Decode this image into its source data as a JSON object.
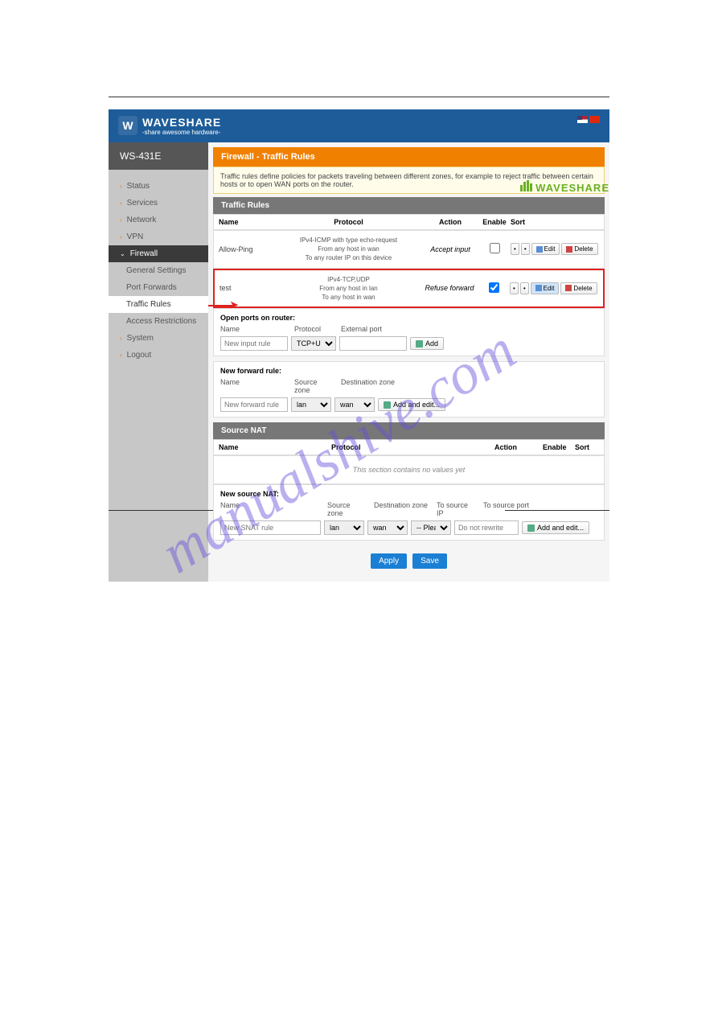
{
  "brand": {
    "name": "WAVESHARE",
    "tagline": "-share awesome hardware-"
  },
  "device": "WS-431E",
  "nav": {
    "status": "Status",
    "services": "Services",
    "network": "Network",
    "vpn": "VPN",
    "firewall": "Firewall",
    "system": "System",
    "logout": "Logout"
  },
  "subnav": {
    "general": "General Settings",
    "portfwd": "Port Forwards",
    "traffic": "Traffic Rules",
    "access": "Access Restrictions"
  },
  "page": {
    "title": "Firewall - Traffic Rules",
    "desc": "Traffic rules define policies for packets traveling between different zones, for example to reject traffic between certain hosts or to open WAN ports on the router."
  },
  "traffic": {
    "section": "Traffic Rules",
    "headers": {
      "name": "Name",
      "protocol": "Protocol",
      "action": "Action",
      "enable": "Enable",
      "sort": "Sort"
    },
    "rules": [
      {
        "name": "Allow-Ping",
        "proto_l1": "IPv4-ICMP with type echo-request",
        "proto_l2": "From any host in wan",
        "proto_l3": "To any router IP on this device",
        "action": "Accept input",
        "enabled": false,
        "highlighted": false
      },
      {
        "name": "test",
        "proto_l1": "IPv4-TCP,UDP",
        "proto_l2": "From any host in lan",
        "proto_l3": "To any host in wan",
        "action": "Refuse forward",
        "enabled": true,
        "highlighted": true
      }
    ],
    "sort_up": "•",
    "sort_down": "•",
    "edit": "Edit",
    "delete": "Delete"
  },
  "openports": {
    "title": "Open ports on router:",
    "name": "Name",
    "protocol": "Protocol",
    "extport": "External port",
    "name_ph": "New input rule",
    "proto_sel": "TCP+UDP",
    "add": "Add"
  },
  "newfwd": {
    "title": "New forward rule:",
    "name": "Name",
    "srczone": "Source zone",
    "dstzone": "Destination zone",
    "name_ph": "New forward rule",
    "src_sel": "lan",
    "dst_sel": "wan",
    "add": "Add and edit..."
  },
  "snat": {
    "section": "Source NAT",
    "headers": {
      "name": "Name",
      "protocol": "Protocol",
      "action": "Action",
      "enable": "Enable",
      "sort": "Sort"
    },
    "empty": "This section contains no values yet"
  },
  "newsnat": {
    "title": "New source NAT:",
    "name": "Name",
    "srczone": "Source zone",
    "dstzone": "Destination zone",
    "tosrcip": "To source IP",
    "tosrcport": "To source port",
    "name_ph": "New SNAT rule",
    "src_sel": "lan",
    "dst_sel": "wan",
    "ip_sel": "-- Please choo",
    "port_ph": "Do not rewrite",
    "add": "Add and edit..."
  },
  "actions": {
    "apply": "Apply",
    "save": "Save"
  },
  "watermark": "manualshive.com",
  "logo_text": "WAVESHARE"
}
